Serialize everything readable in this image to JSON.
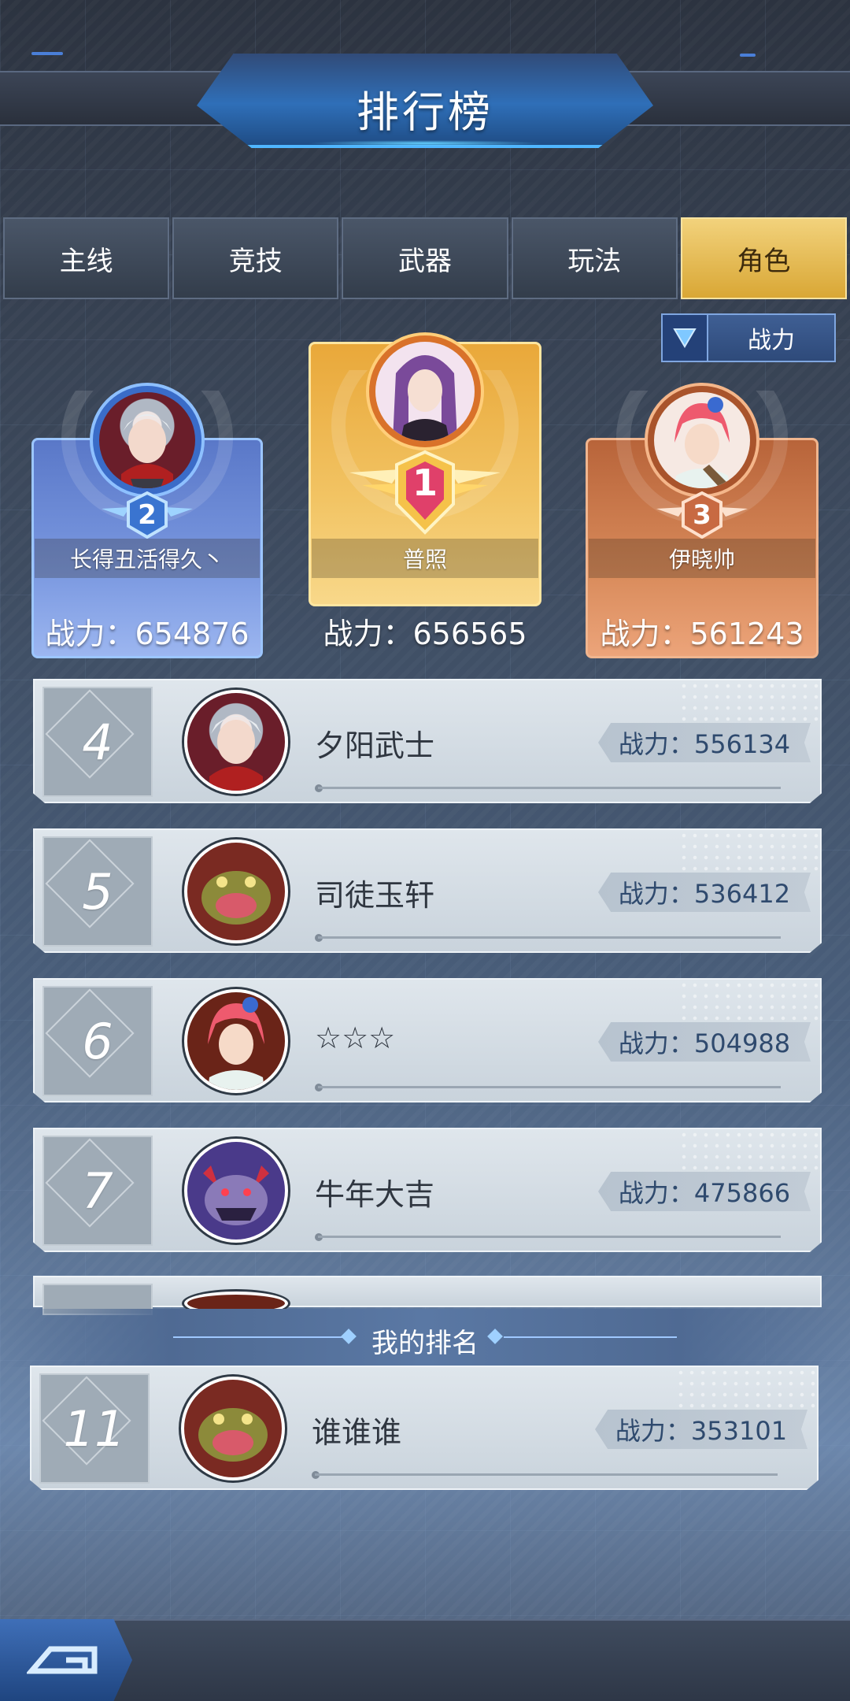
{
  "header": {
    "title": "排行榜"
  },
  "tabs": [
    {
      "label": "主线",
      "active": false
    },
    {
      "label": "竞技",
      "active": false
    },
    {
      "label": "武器",
      "active": false
    },
    {
      "label": "玩法",
      "active": false
    },
    {
      "label": "角色",
      "active": true
    }
  ],
  "sort": {
    "label": "战力",
    "icon": "triangle-down-icon"
  },
  "podium": {
    "first": {
      "rank": "1",
      "name": "普照",
      "power": "战力：656565"
    },
    "second": {
      "rank": "2",
      "name": "长得丑活得久丶",
      "power": "战力：654876"
    },
    "third": {
      "rank": "3",
      "name": "伊晓帅",
      "power": "战力：561243"
    }
  },
  "ranking": [
    {
      "rank": "4",
      "name": "夕阳武士",
      "power": "战力：556134"
    },
    {
      "rank": "5",
      "name": "司徒玉轩",
      "power": "战力：536412"
    },
    {
      "rank": "6",
      "name": "☆☆☆",
      "power": "战力：504988"
    },
    {
      "rank": "7",
      "name": "牛年大吉",
      "power": "战力：475866"
    }
  ],
  "my_rank": {
    "label": "我的排名",
    "rank": "11",
    "name": "谁谁谁",
    "power": "战力：353101"
  },
  "colors": {
    "tab_active": "#e4bb55",
    "gold": "#f2c464",
    "silver_blue": "#7a98e0",
    "bronze": "#d88a5a",
    "power_text": "#2f4a6e"
  }
}
